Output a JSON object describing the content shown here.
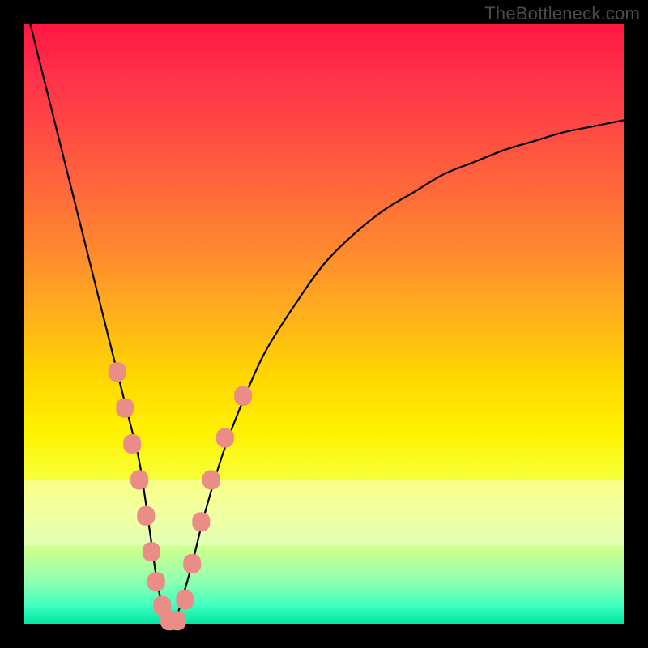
{
  "watermark": "TheBottleneck.com",
  "chart_data": {
    "type": "line",
    "title": "",
    "xlabel": "",
    "ylabel": "",
    "xlim": [
      0,
      100
    ],
    "ylim": [
      0,
      100
    ],
    "series": [
      {
        "name": "bottleneck-curve",
        "x": [
          1,
          3,
          5,
          7,
          9,
          11,
          13,
          15,
          17,
          19,
          20,
          21,
          22,
          23,
          24,
          25,
          26,
          28,
          30,
          33,
          36,
          40,
          45,
          50,
          55,
          60,
          65,
          70,
          75,
          80,
          85,
          90,
          95,
          100
        ],
        "y": [
          100,
          92,
          84,
          76,
          68,
          60,
          52,
          44,
          36,
          28,
          22,
          15,
          8,
          3,
          0,
          0,
          3,
          10,
          18,
          28,
          36,
          45,
          53,
          60,
          65,
          69,
          72,
          75,
          77,
          79,
          80.5,
          82,
          83,
          84
        ]
      }
    ],
    "markers": {
      "name": "highlighted-points",
      "color": "#e98d86",
      "points": [
        {
          "x": 15.5,
          "y": 42
        },
        {
          "x": 16.8,
          "y": 36
        },
        {
          "x": 18.0,
          "y": 30
        },
        {
          "x": 19.2,
          "y": 24
        },
        {
          "x": 20.3,
          "y": 18
        },
        {
          "x": 21.2,
          "y": 12
        },
        {
          "x": 22.0,
          "y": 7
        },
        {
          "x": 23.0,
          "y": 3
        },
        {
          "x": 24.2,
          "y": 0.5
        },
        {
          "x": 25.5,
          "y": 0.5
        },
        {
          "x": 26.8,
          "y": 4
        },
        {
          "x": 28.0,
          "y": 10
        },
        {
          "x": 29.5,
          "y": 17
        },
        {
          "x": 31.2,
          "y": 24
        },
        {
          "x": 33.5,
          "y": 31
        },
        {
          "x": 36.5,
          "y": 38
        }
      ]
    },
    "light_band": {
      "y_from": 13,
      "y_to": 24
    }
  }
}
